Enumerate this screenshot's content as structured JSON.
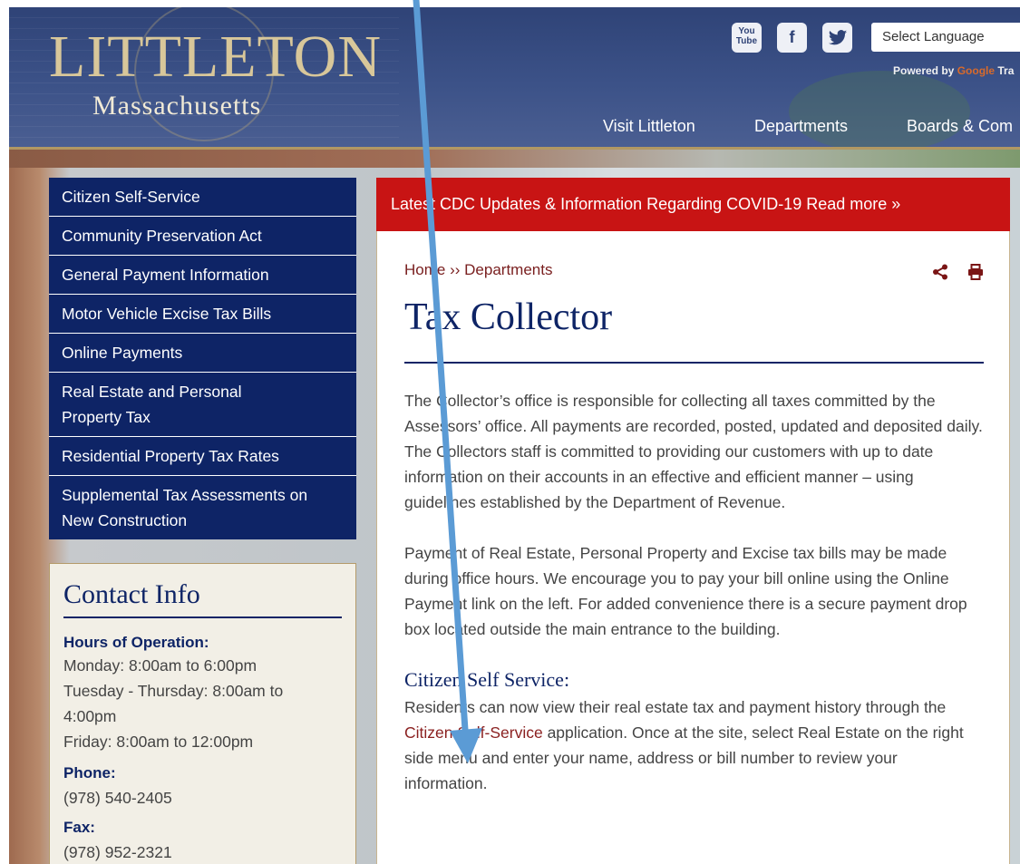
{
  "header": {
    "logo_title": "LITTLETON",
    "logo_subtitle": "Massachusetts",
    "social": {
      "youtube": "You Tube",
      "facebook": "f",
      "twitter": "t"
    },
    "language_select": "Select Language",
    "powered_by": "Powered by",
    "powered_google": "Google",
    "powered_translate": "Tra",
    "nav": [
      "Visit Littleton",
      "Departments",
      "Boards & Com"
    ]
  },
  "sidebar": {
    "items": [
      {
        "label": "Citizen Self-Service"
      },
      {
        "label": "Community Preservation Act"
      },
      {
        "label": "General Payment Information"
      },
      {
        "label": "Motor Vehicle Excise Tax Bills"
      },
      {
        "label": "Online Payments"
      },
      {
        "label": "Real Estate and Personal Property Tax"
      },
      {
        "label": "Residential Property Tax Rates"
      },
      {
        "label": "Supplemental Tax Assessments on New Construction"
      }
    ]
  },
  "contact": {
    "title": "Contact Info",
    "hours_label": "Hours of Operation:",
    "hours": [
      "Monday: 8:00am to 6:00pm",
      "Tuesday - Thursday: 8:00am to 4:00pm",
      "Friday: 8:00am to 12:00pm"
    ],
    "phone_label": "Phone:",
    "phone": "(978) 540-2405",
    "fax_label": "Fax:",
    "fax": "(978) 952-2321"
  },
  "alert": {
    "text": "Latest CDC Updates & Information Regarding COVID-19 Read more »"
  },
  "breadcrumb": {
    "home": "Home",
    "separator": "››",
    "current": "Departments"
  },
  "tools": {
    "share_icon": "share-icon",
    "print_icon": "print-icon"
  },
  "page": {
    "title": "Tax Collector",
    "paragraph1": "The Collector’s office is responsible for collecting all taxes committed by the Assessors’ office. All payments are recorded, posted, updated and deposited daily. The Collectors staff is committed to providing our customers with up to date information on their accounts in an effective and efficient manner – using guidelines established by the Department of Revenue.",
    "paragraph2": "Payment of Real Estate, Personal Property and Excise tax bills may be made during office hours. We encourage you to pay your bill online using the Online Payment link on the left. For added convenience there is a secure payment drop box located outside the main entrance to the building.",
    "subheading": "Citizen Self Service:",
    "p3_before": "Residents can now view their real estate tax and payment history through the ",
    "p3_link": "Citizen Self-Service",
    "p3_after": " application.  Once at the site, select Real Estate on the right side menu and enter your name, address or bill number to review your information."
  },
  "colors": {
    "navy": "#0e2466",
    "alert_red": "#c81414",
    "link_red": "#8a1f1f",
    "arrow_blue": "#5b9bd5"
  }
}
